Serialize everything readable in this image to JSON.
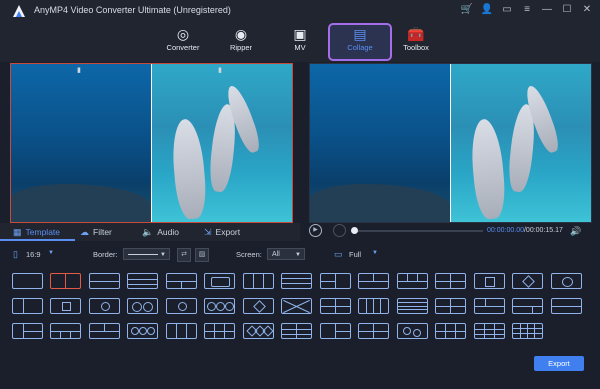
{
  "app": {
    "title": "AnyMP4 Video Converter Ultimate (Unregistered)"
  },
  "window_icons": [
    "cart-icon",
    "user-icon",
    "feedback-icon",
    "menu-icon",
    "minimize-icon",
    "maximize-icon",
    "close-icon"
  ],
  "toolbar": {
    "items": [
      {
        "label": "Converter",
        "icon": "converter-icon"
      },
      {
        "label": "Ripper",
        "icon": "ripper-icon"
      },
      {
        "label": "MV",
        "icon": "mv-icon"
      },
      {
        "label": "Collage",
        "icon": "collage-icon",
        "active": true
      },
      {
        "label": "Toolbox",
        "icon": "toolbox-icon"
      }
    ]
  },
  "tabs": [
    {
      "label": "Template",
      "icon": "grid-icon",
      "active": true
    },
    {
      "label": "Filter",
      "icon": "cloud-icon"
    },
    {
      "label": "Audio",
      "icon": "speaker-icon"
    },
    {
      "label": "Export",
      "icon": "export-icon"
    }
  ],
  "player": {
    "current_time": "00:00:00.00",
    "total_time": "/00:00:15.17"
  },
  "options": {
    "aspect": "16:9",
    "border_label": "Border:",
    "screen_label": "Screen:",
    "screen_value": "All",
    "full_label": "Full"
  },
  "export": {
    "label": "Export"
  },
  "colors": {
    "accent": "#5b8ef0",
    "active_border": "#a46ee8",
    "selected_template": "#e25a45",
    "export_button": "#3f7ff0"
  }
}
